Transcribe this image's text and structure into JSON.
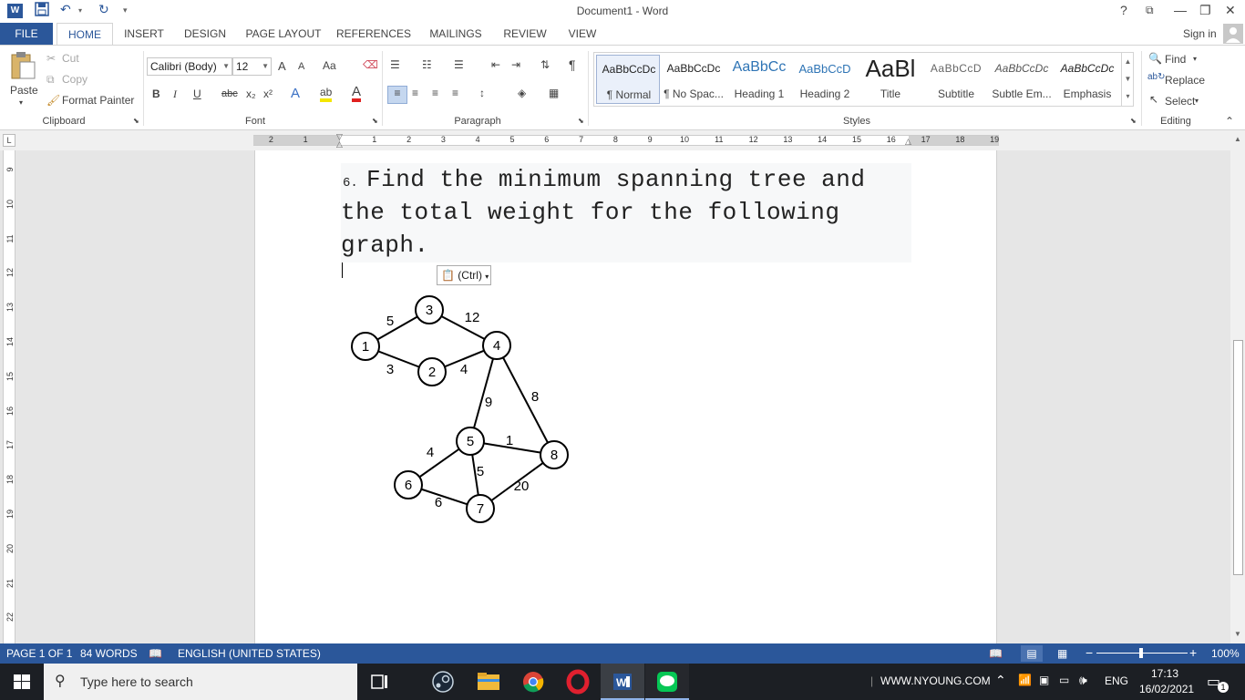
{
  "window": {
    "title": "Document1 - Word",
    "help": "?",
    "minimize": "—",
    "restore": "❐",
    "close": "✕",
    "ribbon_display": "⧉"
  },
  "tabs": [
    "FILE",
    "HOME",
    "INSERT",
    "DESIGN",
    "PAGE LAYOUT",
    "REFERENCES",
    "MAILINGS",
    "REVIEW",
    "VIEW"
  ],
  "signin": "Sign in",
  "clipboard": {
    "paste": "Paste",
    "cut": "Cut",
    "copy": "Copy",
    "format_painter": "Format Painter",
    "label": "Clipboard"
  },
  "font": {
    "name": "Calibri (Body)",
    "size": "12",
    "grow": "A",
    "shrink": "A",
    "change_case": "Aa",
    "bold": "B",
    "italic": "I",
    "underline": "U",
    "strikethrough": "abc",
    "subscript": "x₂",
    "superscript": "x²",
    "text_effects": "A",
    "highlight": "ab",
    "font_color": "A",
    "label": "Font"
  },
  "paragraph": {
    "label": "Paragraph",
    "show_marks": "¶"
  },
  "styles": {
    "label": "Styles",
    "items": [
      {
        "sample": "AaBbCcDc",
        "name": "¶ Normal"
      },
      {
        "sample": "AaBbCcDc",
        "name": "¶ No Spac..."
      },
      {
        "sample": "AaBbCc",
        "name": "Heading 1"
      },
      {
        "sample": "AaBbCcD",
        "name": "Heading 2"
      },
      {
        "sample": "AaBl",
        "name": "Title"
      },
      {
        "sample": "AaBbCcD",
        "name": "Subtitle"
      },
      {
        "sample": "AaBbCcDc",
        "name": "Subtle Em..."
      },
      {
        "sample": "AaBbCcDc",
        "name": "Emphasis"
      }
    ]
  },
  "editing": {
    "find": "Find",
    "replace": "Replace",
    "select": "Select",
    "label": "Editing"
  },
  "ruler": {
    "h_left": [
      "2",
      "1"
    ],
    "h_numbers": [
      "1",
      "2",
      "3",
      "4",
      "5",
      "6",
      "7",
      "8",
      "9",
      "10",
      "11",
      "12",
      "13",
      "14",
      "15",
      "16",
      "17",
      "18",
      "19"
    ],
    "v_numbers": [
      "9",
      "10",
      "11",
      "12",
      "13",
      "14",
      "15",
      "16",
      "17",
      "18",
      "19",
      "20",
      "21",
      "22"
    ],
    "corner": "L"
  },
  "document": {
    "question_number": "6.",
    "question": "Find the minimum spanning tree and the total weight for the following graph.",
    "paste_options": "(Ctrl)",
    "graph": {
      "nodes": [
        "1",
        "2",
        "3",
        "4",
        "5",
        "6",
        "7",
        "8"
      ],
      "edges": [
        {
          "from": "1",
          "to": "3",
          "weight": "5"
        },
        {
          "from": "3",
          "to": "4",
          "weight": "12"
        },
        {
          "from": "1",
          "to": "2",
          "weight": "3"
        },
        {
          "from": "2",
          "to": "4",
          "weight": "4"
        },
        {
          "from": "4",
          "to": "5",
          "weight": "9"
        },
        {
          "from": "4",
          "to": "8",
          "weight": "8"
        },
        {
          "from": "5",
          "to": "8",
          "weight": "1"
        },
        {
          "from": "5",
          "to": "6",
          "weight": "4"
        },
        {
          "from": "5",
          "to": "7",
          "weight": "5"
        },
        {
          "from": "7",
          "to": "8",
          "weight": "20"
        },
        {
          "from": "6",
          "to": "7",
          "weight": "6"
        }
      ]
    }
  },
  "status": {
    "page": "PAGE 1 OF 1",
    "words": "84 WORDS",
    "language": "ENGLISH (UNITED STATES)",
    "zoom": "100%",
    "zoom_out": "−",
    "zoom_in": "+"
  },
  "taskbar": {
    "search_placeholder": "Type here to search",
    "tray_label": "WWW.NYOUNG.COM",
    "lang": "ENG",
    "time": "17:13",
    "date": "16/02/2021",
    "notifications": "1"
  },
  "colors": {
    "word_blue": "#2b579a",
    "taskbar": "#1c1f24"
  }
}
